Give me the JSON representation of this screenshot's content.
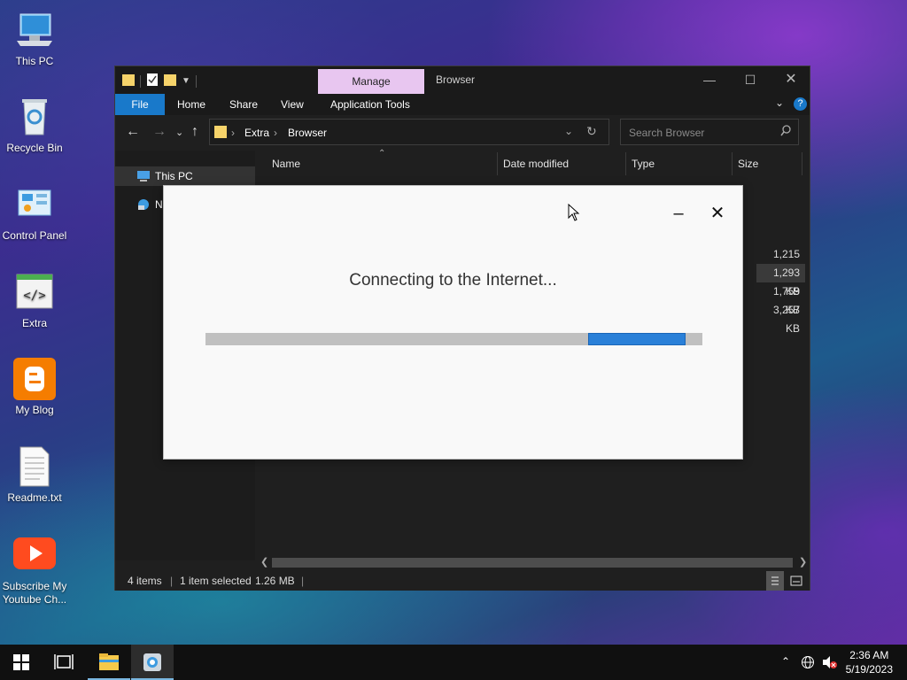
{
  "desktop": {
    "icons": [
      {
        "label": "This PC",
        "icon": "this-pc-icon"
      },
      {
        "label": "Recycle Bin",
        "icon": "recycle-bin-icon"
      },
      {
        "label": "Control Panel",
        "icon": "control-panel-icon"
      },
      {
        "label": "Extra",
        "icon": "code-file-icon"
      },
      {
        "label": "My Blog",
        "icon": "blogger-icon"
      },
      {
        "label": "Readme.txt",
        "icon": "text-file-icon"
      },
      {
        "label": "Subscribe My Youtube Ch...",
        "icon": "youtube-icon"
      }
    ]
  },
  "explorer": {
    "manage_tab": "Manage",
    "window_title": "Browser",
    "ribbon": {
      "file": "File",
      "home": "Home",
      "share": "Share",
      "view": "View",
      "app_tools": "Application Tools"
    },
    "breadcrumb": [
      "Extra",
      "Browser"
    ],
    "search_placeholder": "Search Browser",
    "nav": {
      "this_pc": "This PC",
      "network": "N"
    },
    "columns": {
      "name": "Name",
      "date": "Date modified",
      "type": "Type",
      "size": "Size"
    },
    "sizes": [
      "1,215 KB",
      "1,293 KB",
      "1,759 KB",
      "3,257 KB"
    ],
    "status": {
      "items": "4 items",
      "selected": "1 item selected",
      "size": "1.26 MB"
    }
  },
  "dialog": {
    "message": "Connecting to the Internet...",
    "progress": {
      "indeterminate": true,
      "segment_start": 0.77,
      "segment_end": 0.967
    }
  },
  "taskbar": {
    "time": "2:36 AM",
    "date": "5/19/2023"
  },
  "colors": {
    "accent": "#1979ca",
    "manage_tab": "#e8c6f0",
    "progress_fill": "#2a80d8",
    "progress_track": "#c0c0c0"
  }
}
